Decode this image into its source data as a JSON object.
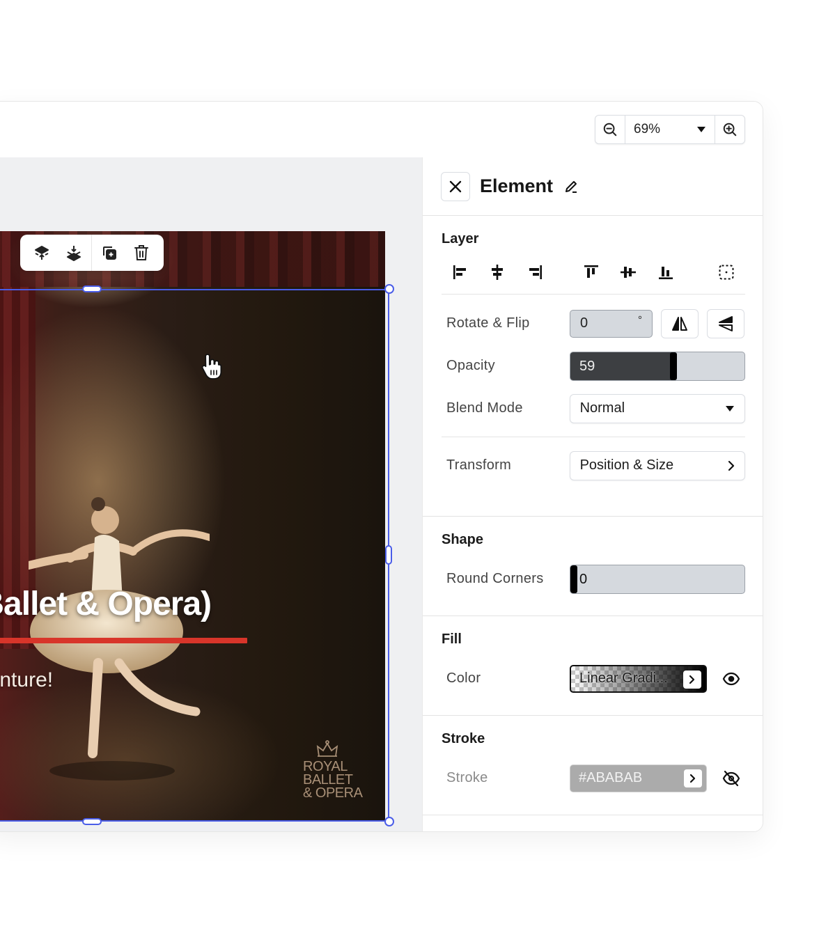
{
  "zoom": {
    "value": "69%"
  },
  "artboard": {
    "headline": "al Ballet & Opera)",
    "tagline": "dventure!",
    "brand_lines": [
      "ROYAL",
      "BALLET",
      "& OPERA"
    ]
  },
  "panel": {
    "title": "Element",
    "layer": {
      "title": "Layer",
      "rotate_label": "Rotate & Flip",
      "rotate_value": "0",
      "rotate_unit": "°",
      "opacity_label": "Opacity",
      "opacity_value": "59",
      "opacity_fraction": 0.59,
      "blend_label": "Blend Mode",
      "blend_value": "Normal",
      "transform_label": "Transform",
      "transform_value": "Position & Size"
    },
    "shape": {
      "title": "Shape",
      "corners_label": "Round Corners",
      "corners_value": "0"
    },
    "fill": {
      "title": "Fill",
      "color_label": "Color",
      "color_value": "Linear Gradi..."
    },
    "stroke": {
      "title": "Stroke",
      "stroke_label": "Stroke",
      "stroke_value": "#ABABAB"
    }
  },
  "colors": {
    "selection": "#4a5de8",
    "accent_red": "#d8352a",
    "stroke_gray": "#ABABAB"
  }
}
